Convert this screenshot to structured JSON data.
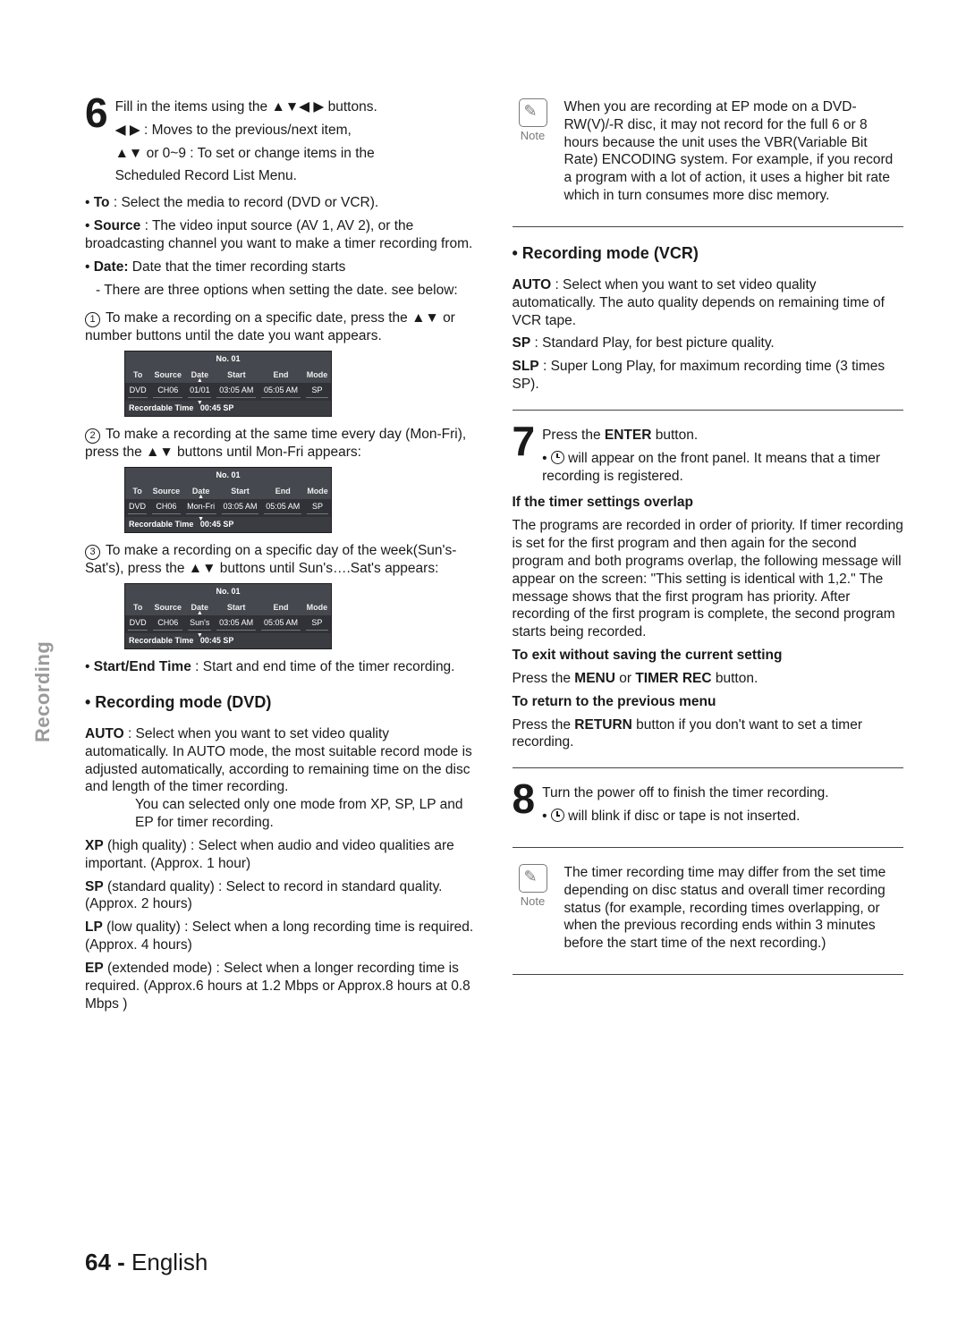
{
  "side_tab": "Recording",
  "step6": {
    "num": "6",
    "line1": "Fill in the items using the ▲▼◀ ▶ buttons.",
    "line2": "◀ ▶ : Moves to the previous/next item,",
    "line3": "▲▼ or 0~9 : To set or change items in the",
    "line4": "Scheduled Record List Menu.",
    "to": {
      "label": "To",
      "text": ": Select the media to record (DVD or VCR)."
    },
    "source": {
      "label": "Source",
      "text": ": The video input source (AV 1, AV 2), or the broadcasting channel you want to make a timer recording from."
    },
    "date": {
      "label": "Date:",
      "text": " Date that the timer recording starts",
      "sub": "- There are three options when setting the date. see below:"
    },
    "opt1": "To make a recording on a specific date, press the ▲▼ or number buttons until the date you want appears.",
    "opt2": "To make a recording at the same time every day (Mon-Fri), press the ▲▼ buttons until Mon-Fri appears:",
    "opt3": "To make a recording on a specific day of the week(Sun's-Sat's), press the ▲▼ buttons until Sun's….Sat's appears:",
    "startend": {
      "label": "Start/End Time",
      "text": " : Start and end time of the timer recording."
    }
  },
  "schedTable": {
    "title": "No. 01",
    "headers": [
      "To",
      "Source",
      "Date",
      "Start",
      "End",
      "Mode"
    ],
    "row_common": {
      "to": "DVD",
      "source": "CH06",
      "start": "03:05 AM",
      "end": "05:05 AM",
      "mode": "SP"
    },
    "dates": [
      "01/01",
      "Mon-Fri",
      "Sun's"
    ],
    "footer_label": "Recordable Time",
    "footer_val": "00:45  SP"
  },
  "dvd": {
    "title": "• Recording mode (DVD)",
    "auto": {
      "label": "AUTO",
      "text": " : Select when you want to set video quality automatically. In AUTO mode, the most suitable record mode is adjusted automatically, according to remaining time on the disc and length of the timer recording.",
      "text2": "You can selected only one mode from XP, SP, LP and EP for timer recording."
    },
    "xp": {
      "label": "XP",
      "qual": " (high quality)",
      "text": " : Select when audio and video qualities are important. (Approx. 1 hour)"
    },
    "sp": {
      "label": "SP",
      "qual": " (standard quality)",
      "text": " : Select to record in standard quality. (Approx. 2 hours)"
    },
    "lp": {
      "label": "LP",
      "qual": " (low quality)",
      "text": " : Select when a long recording time is required.(Approx. 4 hours)"
    },
    "ep": {
      "label": "EP",
      "qual": " (extended mode)",
      "text": " : Select when a longer recording time is required. (Approx.6 hours at 1.2 Mbps or Approx.8 hours at 0.8 Mbps )"
    }
  },
  "note1": {
    "label": "Note",
    "text": "When you are recording at EP mode on a DVD-RW(V)/-R disc, it may not record for the full 6 or 8 hours because the unit uses the VBR(Variable Bit Rate) ENCODING system. For example, if you record a program with a lot of action, it uses a higher bit rate which in turn consumes more disc memory."
  },
  "vcr": {
    "title": "• Recording mode (VCR)",
    "auto": {
      "label": "AUTO",
      "text": " : Select when you want to set video quality automatically. The auto quality depends on remaining time of VCR tape."
    },
    "sp": {
      "label": "SP",
      "text": " : Standard Play, for best picture quality."
    },
    "slp": {
      "label": "SLP",
      "text": " : Super Long Play, for maximum recording time (3 times SP)."
    }
  },
  "step7": {
    "num": "7",
    "line1a": "Press the ",
    "line1b": "ENTER",
    "line1c": " button.",
    "bullet": " will appear on the front panel. It means that a timer recording is registered.",
    "overlap_title": "If the timer settings overlap",
    "overlap_body": "The programs are recorded in order of priority. If timer recording is set for the first program and then again for the second program and both programs overlap, the following message will appear on the screen: \"This setting is identical with 1,2.\" The message shows that the first program has priority. After recording of the first program is complete, the second program starts being recorded.",
    "exit_title": "To exit without saving the current setting",
    "exit_body_a": "Press the ",
    "exit_body_b": "MENU",
    "exit_body_c": " or ",
    "exit_body_d": "TIMER REC",
    "exit_body_e": " button.",
    "return_title": "To return to the previous menu",
    "return_body_a": "Press the ",
    "return_body_b": "RETURN",
    "return_body_c": " button if you don't want to set a timer recording."
  },
  "step8": {
    "num": "8",
    "line1": "Turn the power off to finish the timer recording.",
    "bullet": " will blink if disc or tape is not inserted."
  },
  "note2": {
    "label": "Note",
    "text": "The timer recording time may differ from the set time depending on disc status and overall timer recording status (for example, recording times overlapping, or when the previous recording ends within 3 minutes before the start time of the next recording.)"
  },
  "footer": {
    "page": "64 -",
    "lang": "English"
  }
}
